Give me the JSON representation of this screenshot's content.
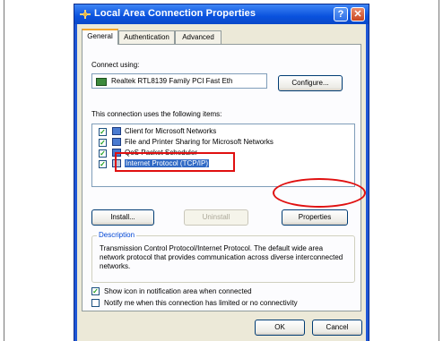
{
  "window": {
    "title": "Local Area Connection Properties",
    "help_label": "?",
    "close_label": "✕"
  },
  "tabs": [
    {
      "label": "General",
      "active": true
    },
    {
      "label": "Authentication",
      "active": false
    },
    {
      "label": "Advanced",
      "active": false
    }
  ],
  "connect_using": {
    "label": "Connect using:",
    "adapter": "Realtek RTL8139 Family PCI Fast Eth",
    "configure_label": "Configure..."
  },
  "items": {
    "label": "This connection uses the following items:",
    "list": [
      {
        "label": "Client for Microsoft Networks",
        "checked": true,
        "selected": false
      },
      {
        "label": "File and Printer Sharing for Microsoft Networks",
        "checked": true,
        "selected": false
      },
      {
        "label": "QoS Packet Scheduler",
        "checked": true,
        "selected": false
      },
      {
        "label": "Internet Protocol (TCP/IP)",
        "checked": true,
        "selected": true
      }
    ]
  },
  "buttons": {
    "install": "Install...",
    "uninstall": "Uninstall",
    "properties": "Properties"
  },
  "description": {
    "legend": "Description",
    "text": "Transmission Control Protocol/Internet Protocol. The default wide area network protocol that provides communication across diverse interconnected networks."
  },
  "options": [
    {
      "label": "Show icon in notification area when connected",
      "checked": true
    },
    {
      "label": "Notify me when this connection has limited or no connectivity",
      "checked": false
    }
  ],
  "footer": {
    "ok": "OK",
    "cancel": "Cancel"
  },
  "colors": {
    "titlebar": "#0a52de",
    "highlight": "#e01010",
    "selection": "#316ac5"
  }
}
